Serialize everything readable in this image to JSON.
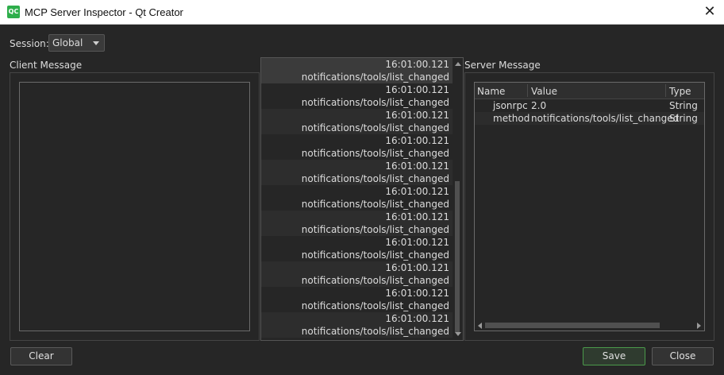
{
  "window": {
    "title": "MCP Server Inspector - Qt Creator",
    "app_icon_text": "QC"
  },
  "session": {
    "label": "Session:",
    "value": "Global"
  },
  "client": {
    "label": "Client Message",
    "text": ""
  },
  "messages": [
    {
      "time": "16:01:00.121",
      "method": "notifications/tools/list_changed"
    },
    {
      "time": "16:01:00.121",
      "method": "notifications/tools/list_changed"
    },
    {
      "time": "16:01:00.121",
      "method": "notifications/tools/list_changed"
    },
    {
      "time": "16:01:00.121",
      "method": "notifications/tools/list_changed"
    },
    {
      "time": "16:01:00.121",
      "method": "notifications/tools/list_changed"
    },
    {
      "time": "16:01:00.121",
      "method": "notifications/tools/list_changed"
    },
    {
      "time": "16:01:00.121",
      "method": "notifications/tools/list_changed"
    },
    {
      "time": "16:01:00.121",
      "method": "notifications/tools/list_changed"
    },
    {
      "time": "16:01:00.121",
      "method": "notifications/tools/list_changed"
    },
    {
      "time": "16:01:00.121",
      "method": "notifications/tools/list_changed"
    },
    {
      "time": "16:01:00.121",
      "method": "notifications/tools/list_changed"
    }
  ],
  "server": {
    "label": "Server Message",
    "columns": [
      "Name",
      "Value",
      "Type"
    ],
    "rows": [
      {
        "name": "jsonrpc",
        "value": "2.0",
        "type": "String"
      },
      {
        "name": "method",
        "value": "notifications/tools/list_changed",
        "type": "String"
      }
    ]
  },
  "buttons": {
    "clear": "Clear",
    "save": "Save",
    "close": "Close"
  }
}
